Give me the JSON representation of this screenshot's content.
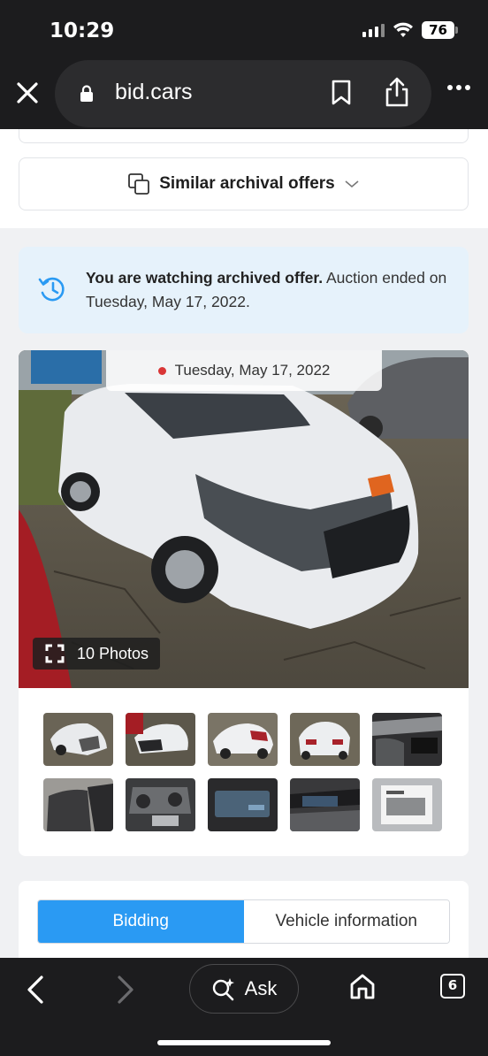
{
  "status_bar": {
    "time": "10:29",
    "battery": "76",
    "icons": [
      "signal-icon",
      "wifi-icon",
      "battery-icon"
    ]
  },
  "browser": {
    "url": "bid.cars",
    "icons": [
      "close-icon",
      "lock-icon",
      "bookmark-icon",
      "share-icon",
      "more-icon"
    ]
  },
  "similar": {
    "label": "Similar archival offers",
    "icons": [
      "copy-icon",
      "chevron-down-icon"
    ]
  },
  "archive_notice": {
    "bold": "You are watching archived offer.",
    "rest": " Auction ended on Tuesday, May 17, 2022.",
    "icon": "history-icon"
  },
  "gallery": {
    "date": "Tuesday, May 17, 2022",
    "photos_label": "10 Photos",
    "thumbnails": [
      "front-left-damaged",
      "front-right-damaged",
      "rear-right",
      "rear",
      "interior-front",
      "rear-seats",
      "engine-bay",
      "dash-screen",
      "dashboard",
      "window-sticker"
    ]
  },
  "tabs": {
    "bidding": "Bidding",
    "vehicle_info": "Vehicle information",
    "active": "Bidding"
  },
  "bottom_bar": {
    "ask_label": "Ask",
    "tab_count": "6",
    "icons": [
      "back-icon",
      "forward-icon",
      "sparkle-search-icon",
      "home-icon",
      "tabs-icon"
    ]
  },
  "colors": {
    "accent": "#2a9af3",
    "notice_bg": "#e6f2fb",
    "chrome_bg": "#1c1c1e",
    "dot_red": "#d93636"
  }
}
